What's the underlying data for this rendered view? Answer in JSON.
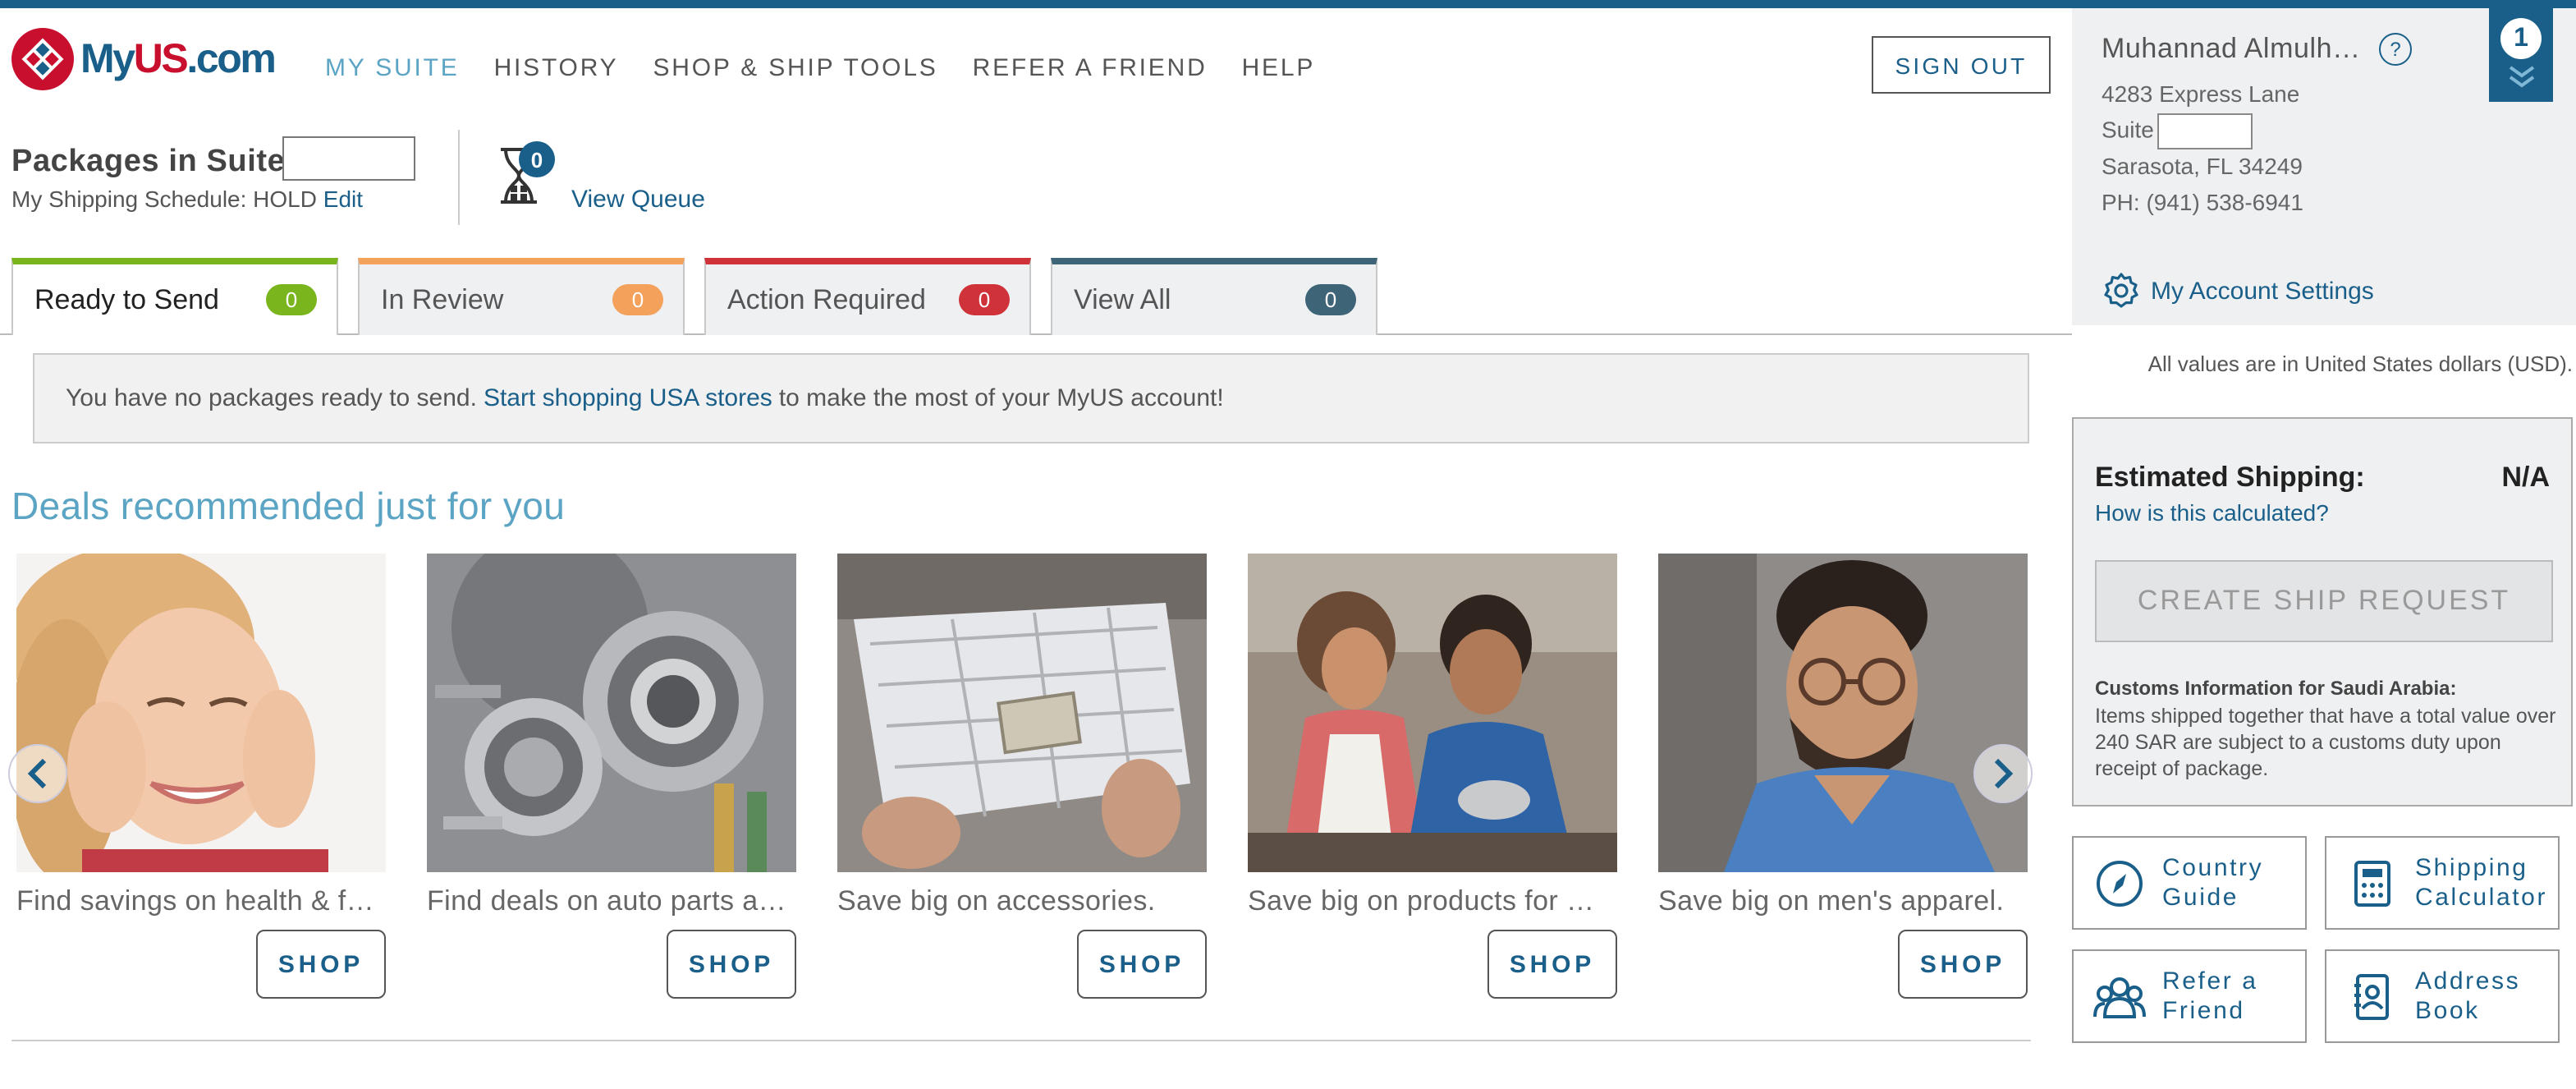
{
  "logo": {
    "my": "My",
    "us": "US",
    "com": ".com"
  },
  "nav": {
    "items": [
      "MY SUITE",
      "HISTORY",
      "SHOP & SHIP TOOLS",
      "REFER A FRIEND",
      "HELP"
    ]
  },
  "header": {
    "sign_out": "SIGN OUT"
  },
  "account": {
    "name": "Muhannad Almulh…",
    "help": "?",
    "address_line1": "4283 Express Lane",
    "suite_label": "Suite",
    "city": "Sarasota, FL 34249",
    "phone": "PH: (941) 538-6941",
    "settings": "My Account Settings"
  },
  "notifications": {
    "count": "1"
  },
  "packages": {
    "title": "Packages in Suite",
    "schedule_label": "My Shipping Schedule: HOLD",
    "edit": "Edit",
    "queue_count": "0",
    "view_queue": "View Queue"
  },
  "tabs": [
    {
      "label": "Ready to Send",
      "count": "0",
      "color": "#7ab51d"
    },
    {
      "label": "In Review",
      "count": "0",
      "color": "#f4a15c"
    },
    {
      "label": "Action Required",
      "count": "0",
      "color": "#d0323a"
    },
    {
      "label": "View All",
      "count": "0",
      "color": "#3e6478"
    }
  ],
  "notice": {
    "pre": "You have no packages ready to send.",
    "link": "Start shopping USA stores",
    "post": "to make the most of your MyUS account!"
  },
  "deals": {
    "title": "Deals recommended just for you",
    "items": [
      {
        "caption": "Find savings on health & f…",
        "button": "SHOP"
      },
      {
        "caption": "Find deals on auto parts a…",
        "button": "SHOP"
      },
      {
        "caption": "Save big on accessories.",
        "button": "SHOP"
      },
      {
        "caption": "Save big on products for …",
        "button": "SHOP"
      },
      {
        "caption": "Save big on men's apparel.",
        "button": "SHOP"
      }
    ]
  },
  "currency_note": "All values are in United States dollars (USD).",
  "estimate": {
    "label": "Estimated Shipping:",
    "value": "N/A",
    "how": "How is this calculated?",
    "create": "CREATE SHIP REQUEST",
    "customs_title": "Customs Information for Saudi Arabia:",
    "customs_text": "Items shipped together that have a total value over 240 SAR are subject to a customs duty upon receipt of package."
  },
  "tools": [
    {
      "line1": "Country",
      "line2": "Guide",
      "icon": "compass-icon"
    },
    {
      "line1": "Shipping",
      "line2": "Calculator",
      "icon": "calculator-icon"
    },
    {
      "line1": "Refer a",
      "line2": "Friend",
      "icon": "people-icon"
    },
    {
      "line1": "Address",
      "line2": "Book",
      "icon": "address-book-icon"
    }
  ],
  "colors": {
    "brand_blue": "#1a5f8a",
    "link_light": "#5ba4c4",
    "brand_red": "#c8102e"
  }
}
